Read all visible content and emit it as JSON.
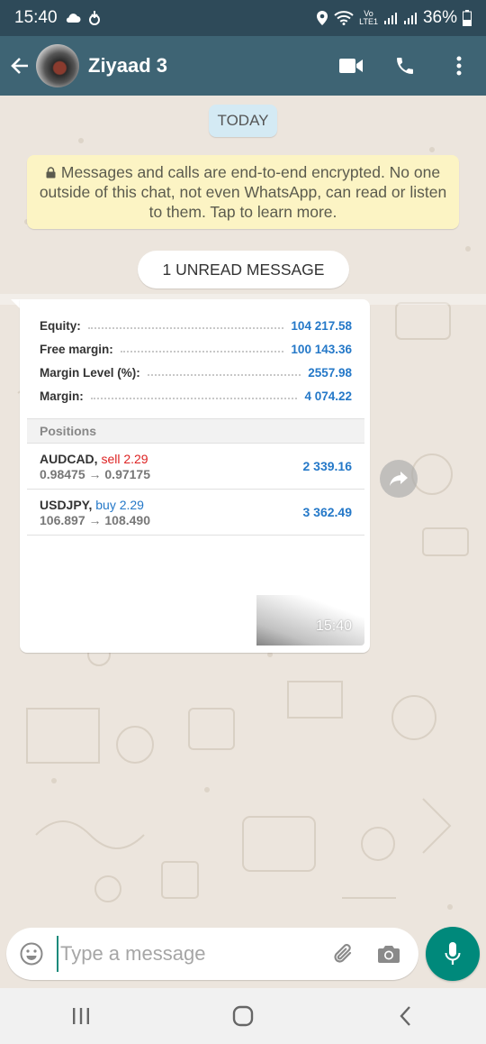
{
  "status_bar": {
    "time": "15:40",
    "volte_top": "Vo",
    "volte_bottom": "LTE1",
    "battery": "36%"
  },
  "header": {
    "contact_name": "Ziyaad 3",
    "icons": [
      "back-arrow-icon",
      "video-call-icon",
      "phone-icon",
      "more-vertical-icon"
    ]
  },
  "chat": {
    "date_label": "TODAY",
    "encryption_notice": "Messages and calls are end-to-end encrypted. No one outside of this chat, not even WhatsApp, can read or listen to them. Tap to learn more.",
    "unread_label": "1 UNREAD MESSAGE",
    "message": {
      "time": "15:40",
      "account": [
        {
          "label": "Equity:",
          "value": "104 217.58"
        },
        {
          "label": "Free margin:",
          "value": "100 143.36"
        },
        {
          "label": "Margin Level (%):",
          "value": "2557.98"
        },
        {
          "label": "Margin:",
          "value": "4 074.22"
        }
      ],
      "positions_header": "Positions",
      "positions": [
        {
          "symbol": "AUDCAD,",
          "action": "sell 2.29",
          "side": "sell",
          "open": "0.98475",
          "arrow": "→",
          "current": "0.97175",
          "profit": "2 339.16"
        },
        {
          "symbol": "USDJPY,",
          "action": "buy 2.29",
          "side": "buy",
          "open": "106.897",
          "arrow": "→",
          "current": "108.490",
          "profit": "3 362.49"
        }
      ]
    }
  },
  "input": {
    "placeholder": "Type a message"
  },
  "colors": {
    "status_bar": "#2e4a59",
    "header": "#3e6474",
    "accent": "#00897b",
    "chat_bg": "#ece5dd",
    "profit_blue": "#2478c8",
    "sell_red": "#dd2222"
  }
}
